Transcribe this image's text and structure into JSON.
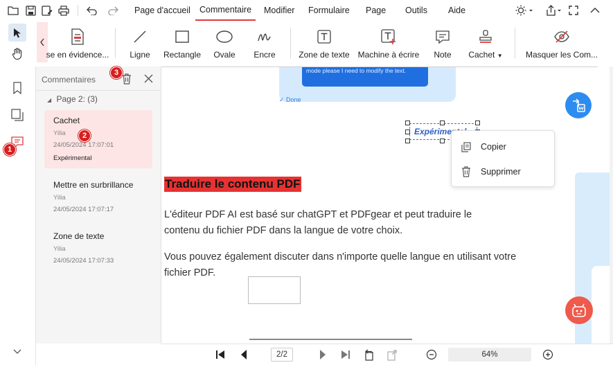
{
  "menu": {
    "tabs": [
      "Page d'accueil",
      "Commentaire",
      "Modifier",
      "Formulaire",
      "Page",
      "Outils",
      "Aide"
    ],
    "active": "Commentaire"
  },
  "ribbon": {
    "highlight_label": "se en évidence...",
    "line": "Ligne",
    "rectangle": "Rectangle",
    "oval": "Ovale",
    "ink": "Encre",
    "textbox": "Zone de texte",
    "typewriter": "Machine à écrire",
    "note": "Note",
    "stamp": "Cachet",
    "hide": "Masquer les Com..."
  },
  "panel": {
    "title": "Commentaires",
    "page_group": "Page 2: (3)",
    "items": [
      {
        "type": "Cachet",
        "user": "Yilia",
        "date": "24/05/2024 17:07:01",
        "text": "Expérimental"
      },
      {
        "type": "Mettre en surbrillance",
        "user": "Yilia",
        "date": "24/05/2024 17:07:17",
        "text": ""
      },
      {
        "type": "Zone de texte",
        "user": "Yilia",
        "date": "24/05/2024 17:07:33",
        "text": ""
      }
    ]
  },
  "badges": {
    "b1": "1",
    "b2": "2",
    "b3": "3"
  },
  "document": {
    "preview_text": "mode please I need to modify the text.",
    "preview_done": "✓ Done",
    "stamp_text": "Expérimental",
    "heading": "Traduire le contenu PDF",
    "para1": "L'éditeur PDF AI est basé sur chatGPT et PDFgear et peut traduire le contenu du fichier PDF dans la langue de votre choix.",
    "para2": "Vous pouvez également discuter dans n'importe quelle langue en utilisant votre fichier PDF."
  },
  "context_menu": {
    "copy": "Copier",
    "delete": "Supprimer"
  },
  "bottom": {
    "page": "2/2",
    "zoom": "64%"
  },
  "colors": {
    "accent": "#e03a3a",
    "selected_bg": "#fde5e5",
    "highlight": "#e63232",
    "blue": "#2d8cf0"
  }
}
